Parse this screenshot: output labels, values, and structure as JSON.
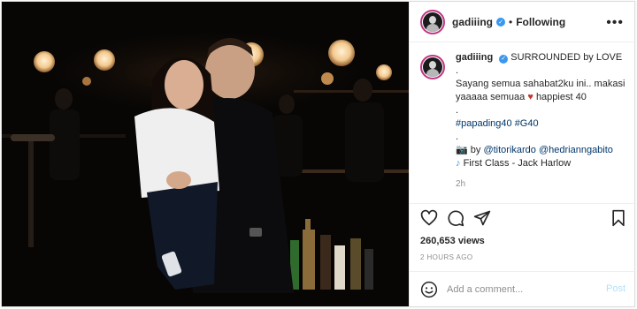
{
  "post": {
    "username": "gadiiing",
    "follow_state": "Following",
    "separator": "•",
    "more_label": "•••"
  },
  "caption": {
    "username": "gadiiing",
    "headline": "SURROUNDED by LOVE",
    "dot1": ".",
    "line1": "Sayang semua sahabat2ku ini.. makasi yaaaaa semuaa",
    "heart": "♥",
    "line1_end": "happiest 40",
    "dot2": ".",
    "hashtag1": "#papading40",
    "hashtag2": "#G40",
    "dot3": ".",
    "credit_prefix": "📷 by",
    "mention1": "@titorikardo",
    "mention2": "@hedrianngabito",
    "music_note": "♪",
    "music": "First Class - Jack Harlow",
    "timestamp": "2h"
  },
  "engagement": {
    "likes": "260,653 views",
    "time_ago": "2 HOURS AGO"
  },
  "comment": {
    "placeholder": "Add a comment...",
    "post_label": "Post"
  },
  "icons": {
    "verified": "verified-badge-icon",
    "more": "more-options-icon",
    "like": "heart-icon",
    "comment": "comment-icon",
    "share": "paper-plane-icon",
    "save": "bookmark-icon",
    "emoji": "smiley-icon"
  },
  "colors": {
    "link": "#00376b",
    "verified": "#3897f0",
    "muted": "#8e8e8e",
    "post_button": "#b2dffc",
    "heart": "#c0392b",
    "avatar_ring": "#c13584"
  }
}
